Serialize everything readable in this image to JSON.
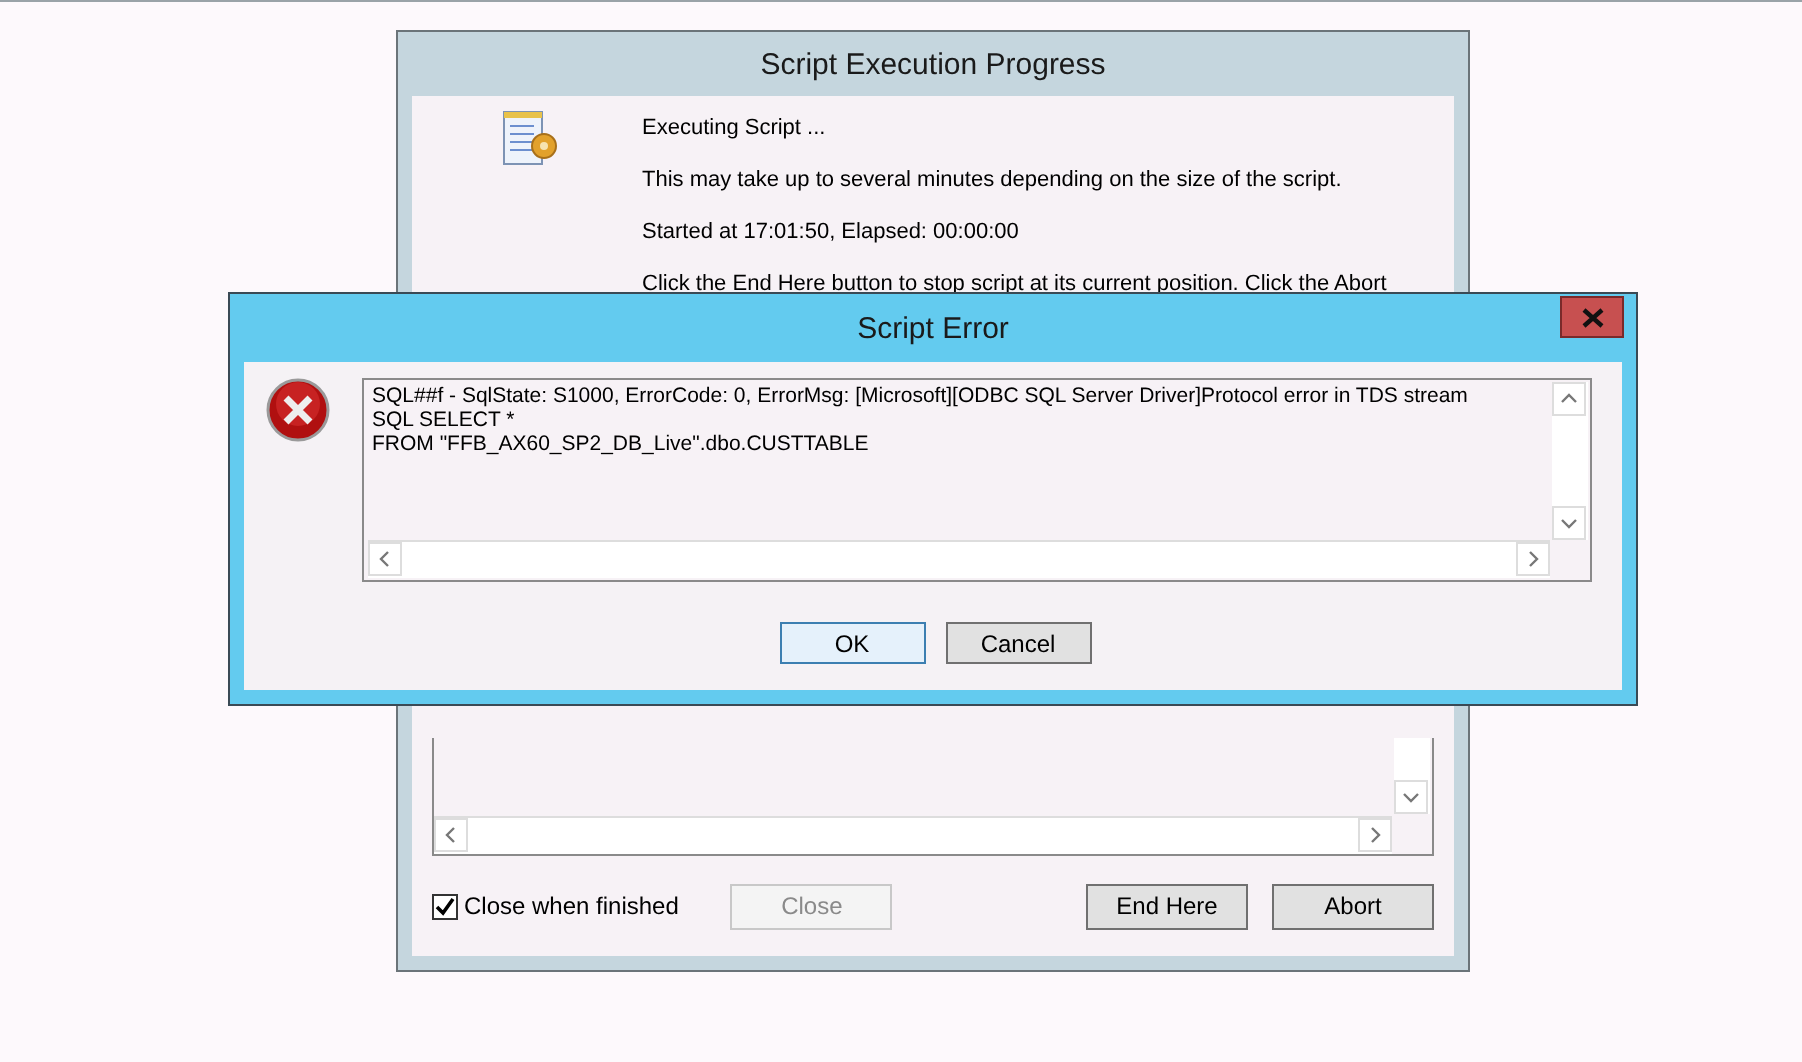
{
  "progress_window": {
    "title": "Script Execution Progress",
    "messages": [
      "Executing Script ...",
      "This may take up to several minutes depending on the size of the script.",
      "Started at 17:01:50, Elapsed: 00:00:00",
      "Click the End Here button to stop script at its current position. Click the Abort"
    ],
    "close_when_finished": {
      "label": "Close when finished",
      "checked": true
    },
    "buttons": [
      {
        "label": "Close",
        "disabled": true
      },
      {
        "label": "End Here",
        "disabled": false
      },
      {
        "label": "Abort",
        "disabled": false
      }
    ]
  },
  "error_dialog": {
    "title": "Script Error",
    "message_lines": [
      "SQL##f - SqlState: S1000, ErrorCode: 0, ErrorMsg: [Microsoft][ODBC SQL Server Driver]Protocol error in TDS stream",
      "SQL SELECT *",
      "FROM \"FFB_AX60_SP2_DB_Live\".dbo.CUSTTABLE"
    ],
    "buttons": [
      {
        "label": "OK",
        "selected": true
      },
      {
        "label": "Cancel",
        "selected": false
      }
    ]
  }
}
